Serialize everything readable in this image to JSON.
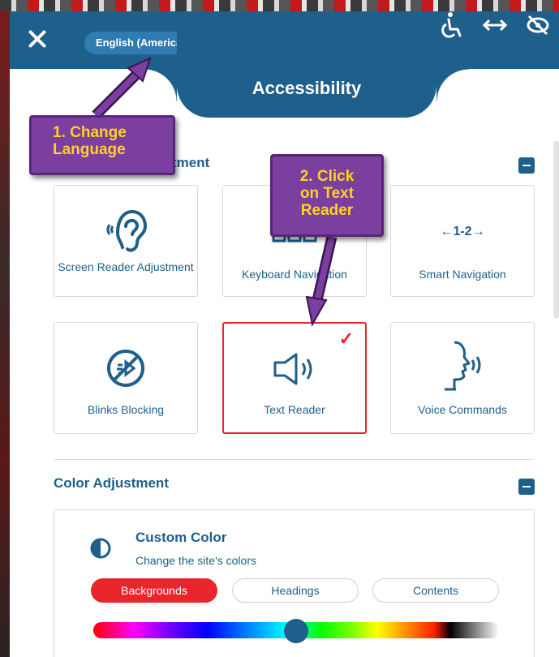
{
  "header": {
    "close_label": "Close",
    "language": "English (American)",
    "title": "Accessibility",
    "icons": [
      "accessibility-person-icon",
      "resize-horizontal-icon",
      "hide-eye-icon"
    ]
  },
  "content_adjustment": {
    "title_partial": "tment",
    "cards": [
      {
        "label": "Screen Reader Adjustment",
        "icon": "ear-sound-icon"
      },
      {
        "label": "Keyboard Navigation",
        "icon": "keyboard-icon"
      },
      {
        "label": "Smart Navigation",
        "icon": "smart-nav-icon",
        "icon_text": "←1-2→"
      },
      {
        "label": "Blinks Blocking",
        "icon": "blink-block-icon"
      },
      {
        "label": "Text Reader",
        "icon": "speaker-icon",
        "active": true,
        "check": "✓"
      },
      {
        "label": "Voice Commands",
        "icon": "voice-head-icon"
      }
    ]
  },
  "color_adjustment": {
    "title": "Color Adjustment",
    "custom_color_title": "Custom Color",
    "custom_color_sub": "Change the site's colors",
    "tabs": [
      "Backgrounds",
      "Headings",
      "Contents"
    ],
    "selected_tab": "Backgrounds"
  },
  "annotations": {
    "step1_line1": "1. Change",
    "step1_line2": "Language",
    "step2_line1": "2. Click",
    "step2_line2": "on Text",
    "step2_line3": "Reader"
  },
  "colors": {
    "primary": "#1e5f8b",
    "accent_red": "#e8262c",
    "callout_bg": "#7b3fa0",
    "callout_text": "#ffd21e"
  }
}
